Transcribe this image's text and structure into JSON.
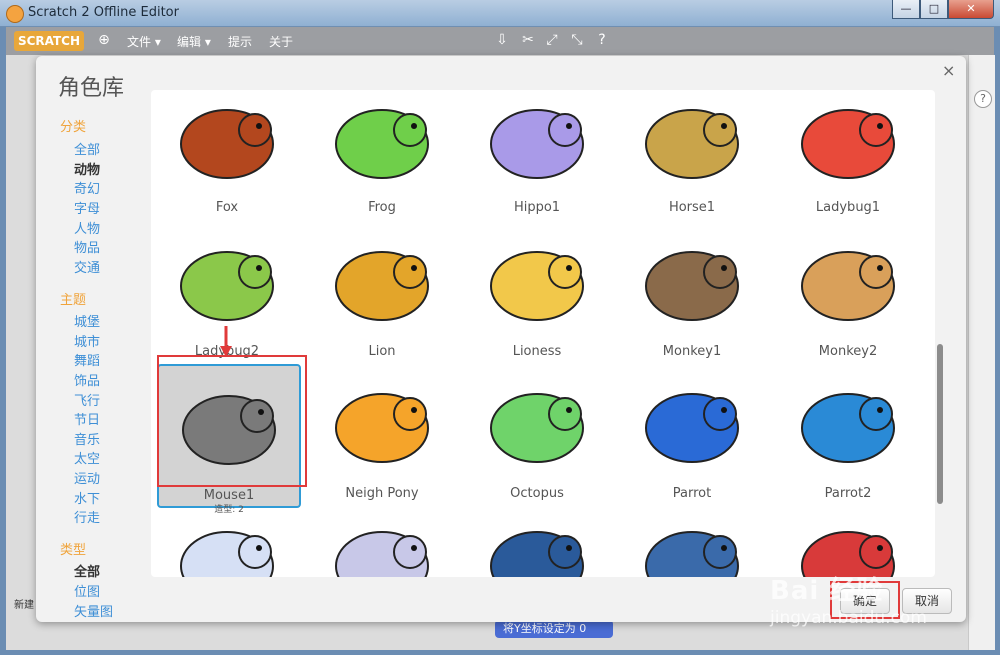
{
  "window": {
    "title": "Scratch 2 Offline Editor",
    "min": "—",
    "max": "□",
    "close": "✕"
  },
  "menubar": {
    "logo": "SCRATCH",
    "items": [
      "文件 ▾",
      "编辑 ▾",
      "提示",
      "关于"
    ],
    "help": "?"
  },
  "background": {
    "block_label": "将Y坐标设定为 0",
    "new_sprite_label": "新建"
  },
  "dialog": {
    "title": "角色库",
    "close": "×",
    "category_head": "分类",
    "categories": [
      "全部",
      "动物",
      "奇幻",
      "字母",
      "人物",
      "物品",
      "交通"
    ],
    "theme_head": "主题",
    "themes": [
      "城堡",
      "城市",
      "舞蹈",
      "饰品",
      "飞行",
      "节日",
      "音乐",
      "太空",
      "运动",
      "水下",
      "行走"
    ],
    "type_head": "类型",
    "types": [
      "全部",
      "位图",
      "矢量图"
    ],
    "ok": "确定",
    "cancel": "取消"
  },
  "sprites": [
    {
      "name": "Fox",
      "color": "#b3471e"
    },
    {
      "name": "Frog",
      "color": "#6fcf4a"
    },
    {
      "name": "Hippo1",
      "color": "#a99ae8"
    },
    {
      "name": "Horse1",
      "color": "#c9a44a"
    },
    {
      "name": "Ladybug1",
      "color": "#e84a3a"
    },
    {
      "name": "Ladybug2",
      "color": "#8bc84a"
    },
    {
      "name": "Lion",
      "color": "#e3a52a"
    },
    {
      "name": "Lioness",
      "color": "#f2c84a"
    },
    {
      "name": "Monkey1",
      "color": "#8a6a4a"
    },
    {
      "name": "Monkey2",
      "color": "#d9a05a"
    },
    {
      "name": "Mouse1",
      "color": "#7a7a7a",
      "costumes": "造型: 2"
    },
    {
      "name": "Neigh Pony",
      "color": "#f5a42a"
    },
    {
      "name": "Octopus",
      "color": "#6fd36a"
    },
    {
      "name": "Parrot",
      "color": "#2a6ad6"
    },
    {
      "name": "Parrot2",
      "color": "#2a8ad6"
    },
    {
      "name": "",
      "color": "#d6e0f5"
    },
    {
      "name": "",
      "color": "#c8c8e8"
    },
    {
      "name": "",
      "color": "#2a5a9a"
    },
    {
      "name": "",
      "color": "#3a6aaa"
    },
    {
      "name": "",
      "color": "#d83a3a"
    }
  ],
  "watermark": {
    "main": "Bai 经验",
    "sub": "jingyan.baidu.com"
  }
}
